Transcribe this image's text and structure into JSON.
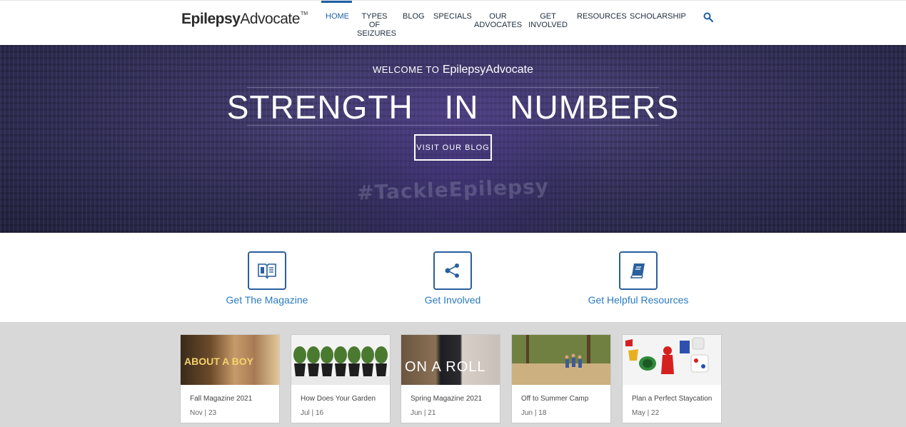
{
  "header": {
    "logo_bold": "Epilepsy",
    "logo_light": "Advocate",
    "logo_tm": "TM",
    "nav": [
      {
        "label": "HOME",
        "active": true
      },
      {
        "label": "TYPES OF SEIZURES"
      },
      {
        "label": "BLOG"
      },
      {
        "label": "SPECIALS"
      },
      {
        "label": "OUR ADVOCATES"
      },
      {
        "label": "GET INVOLVED"
      },
      {
        "label": "RESOURCES"
      },
      {
        "label": "SCHOLARSHIP"
      }
    ],
    "search_icon": "search-icon",
    "accent": "#1f5fa8"
  },
  "hero": {
    "welcome_prefix": "WELCOME TO",
    "welcome_brand": "EpilepsyAdvocate",
    "headline": "STRENGTH IN NUMBERS",
    "cta_label": "VISIT OUR BLOG",
    "hashtag": "#TackleEpilepsy"
  },
  "features": [
    {
      "label": "Get The Magazine",
      "icon": "magazine-icon"
    },
    {
      "label": "Get Involved",
      "icon": "share-icon"
    },
    {
      "label": "Get Helpful Resources",
      "icon": "book-icon"
    }
  ],
  "cards": [
    {
      "title": "Fall Magazine 2021",
      "date": "Nov | 23",
      "cover_text": "ABOUT A BOY"
    },
    {
      "title": "How Does Your Garden",
      "date": "Jul | 16"
    },
    {
      "title": "Spring Magazine 2021",
      "date": "Jun | 21",
      "cover_text": "ON A ROLL"
    },
    {
      "title": "Off to Summer Camp",
      "date": "Jun | 18"
    },
    {
      "title": "Plan a Perfect Staycation",
      "date": "May | 22"
    }
  ]
}
